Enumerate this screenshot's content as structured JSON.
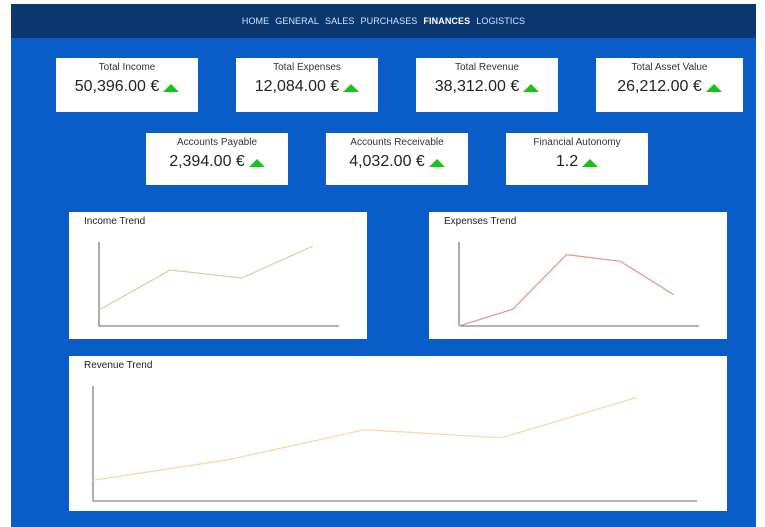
{
  "nav": {
    "items": [
      "HOME",
      "GENERAL",
      "SALES",
      "PURCHASES",
      "FINANCES",
      "LOGISTICS"
    ],
    "active": "FINANCES"
  },
  "kpis": [
    {
      "label": "Total Income",
      "value": "50,396.00 €",
      "trend": "up"
    },
    {
      "label": "Total Expenses",
      "value": "12,084.00 €",
      "trend": "up"
    },
    {
      "label": "Total Revenue",
      "value": "38,312.00 €",
      "trend": "up"
    },
    {
      "label": "Total Asset Value",
      "value": "26,212.00 €",
      "trend": "up"
    },
    {
      "label": "Accounts Payable",
      "value": "2,394.00 €",
      "trend": "up"
    },
    {
      "label": "Accounts Receivable",
      "value": "4,032.00 €",
      "trend": "up"
    },
    {
      "label": "Financial Autonomy",
      "value": "1.2",
      "trend": "up"
    }
  ],
  "colors": {
    "nav_bg": "#0b3770",
    "page_bg": "#0a5cc8",
    "trend_up": "#19c219",
    "income_line": "#c5d7a0",
    "expenses_line": "#ef8f88",
    "revenue_line": "#fbd4a0"
  },
  "chart_data": [
    {
      "type": "line",
      "title": "Income Trend",
      "x": [
        1,
        2,
        3,
        4
      ],
      "series": [
        {
          "values": [
            0.2,
            0.7,
            0.6,
            1.0
          ]
        }
      ],
      "ylim": [
        0,
        1.05
      ],
      "grid": false
    },
    {
      "type": "line",
      "title": "Expenses Trend",
      "x": [
        1,
        2,
        3,
        4,
        5
      ],
      "series": [
        {
          "values": [
            0.0,
            0.2,
            0.85,
            0.77,
            0.37
          ]
        }
      ],
      "ylim": [
        0,
        1.0
      ],
      "grid": false
    },
    {
      "type": "line",
      "title": "Revenue Trend",
      "x": [
        1,
        2,
        3,
        4,
        5
      ],
      "series": [
        {
          "values": [
            0.18,
            0.36,
            0.62,
            0.55,
            0.9
          ]
        }
      ],
      "ylim": [
        0,
        1.0
      ],
      "grid": false
    }
  ]
}
